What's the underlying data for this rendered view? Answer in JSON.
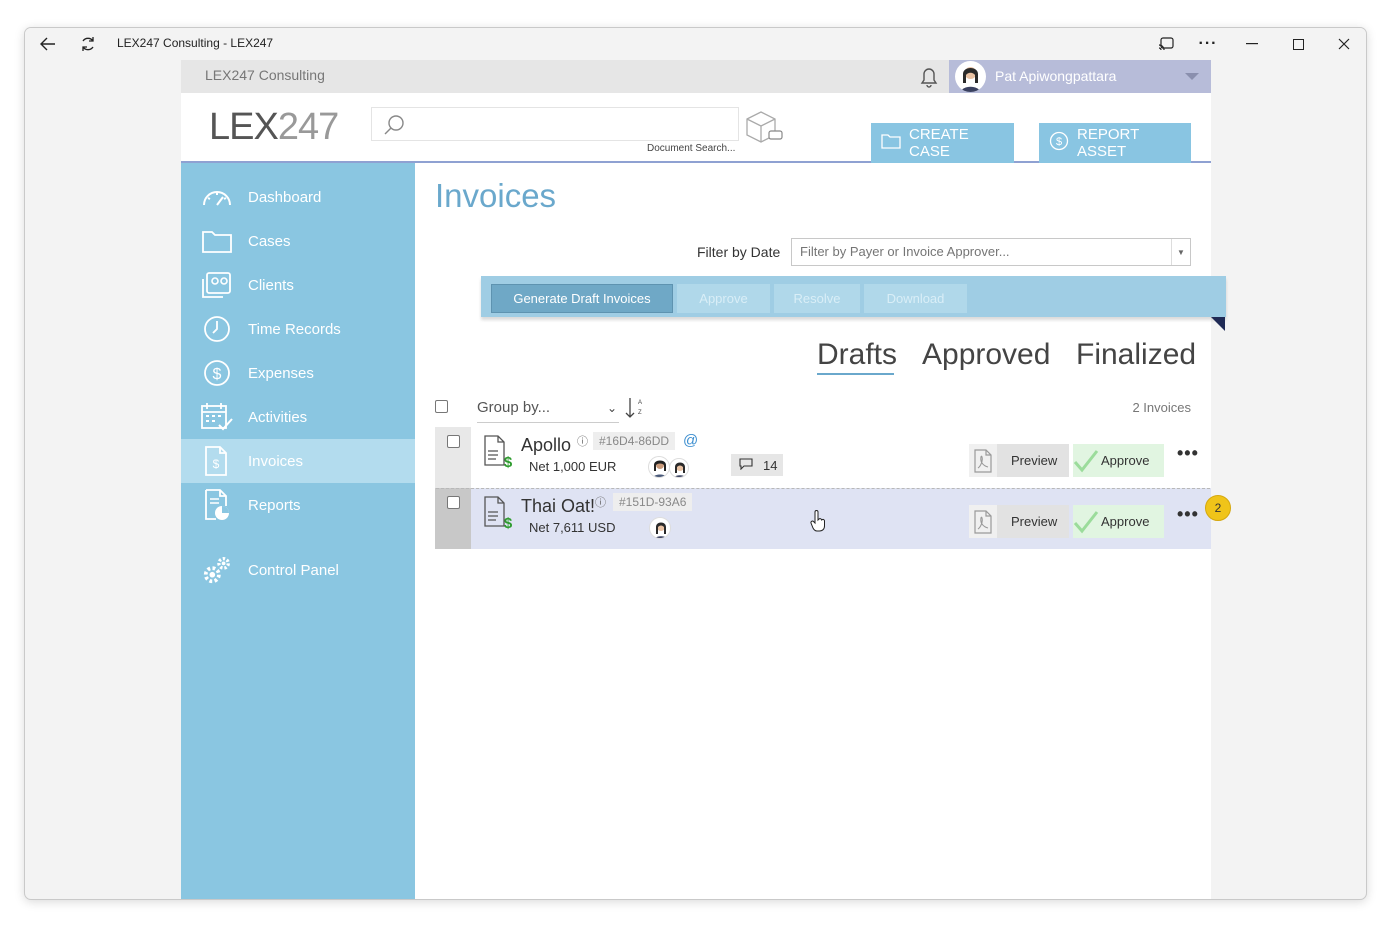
{
  "window": {
    "title": "LEX247 Consulting - LEX247"
  },
  "topbar": {
    "org": "LEX247 Consulting",
    "user_name": "Pat Apiwongpattara"
  },
  "header": {
    "logo_bold": "LEX",
    "logo_thin": "247",
    "search_placeholder": "",
    "doc_search_label": "Document Search...",
    "create_case": "CREATE CASE",
    "report_asset": "REPORT ASSET"
  },
  "sidebar": {
    "items": [
      {
        "label": "Dashboard",
        "icon": "dashboard-icon"
      },
      {
        "label": "Cases",
        "icon": "folder-icon"
      },
      {
        "label": "Clients",
        "icon": "clients-icon"
      },
      {
        "label": "Time Records",
        "icon": "clock-icon"
      },
      {
        "label": "Expenses",
        "icon": "dollar-circle-icon"
      },
      {
        "label": "Activities",
        "icon": "calendar-check-icon"
      },
      {
        "label": "Invoices",
        "icon": "invoice-icon",
        "active": true
      },
      {
        "label": "Reports",
        "icon": "report-icon"
      },
      {
        "label": "Control Panel",
        "icon": "gears-icon"
      }
    ]
  },
  "main": {
    "title": "Invoices",
    "filter_label": "Filter by Date",
    "filter_placeholder": "Filter by Payer or Invoice Approver...",
    "toolbar": {
      "generate": "Generate Draft Invoices",
      "approve": "Approve",
      "resolve": "Resolve",
      "download": "Download"
    },
    "tabs": [
      "Drafts",
      "Approved",
      "Finalized"
    ],
    "active_tab": "Drafts",
    "group_by": "Group by...",
    "count": "2 Invoices",
    "rows": [
      {
        "name": "Apollo",
        "code": "#16D4-86DD",
        "net": "Net 1,000 EUR",
        "comments": "14",
        "preview": "Preview",
        "approve": "Approve"
      },
      {
        "name": "Thai Oat!",
        "code": "#151D-93A6",
        "net": "Net 7,611 USD",
        "preview": "Preview",
        "approve": "Approve"
      }
    ],
    "badge": "2"
  },
  "colors": {
    "sidebar": "#8ac6e1",
    "accent": "#6aa8cc",
    "user_bar": "#b7bcd9",
    "approve_bg": "#e1f5e1"
  }
}
